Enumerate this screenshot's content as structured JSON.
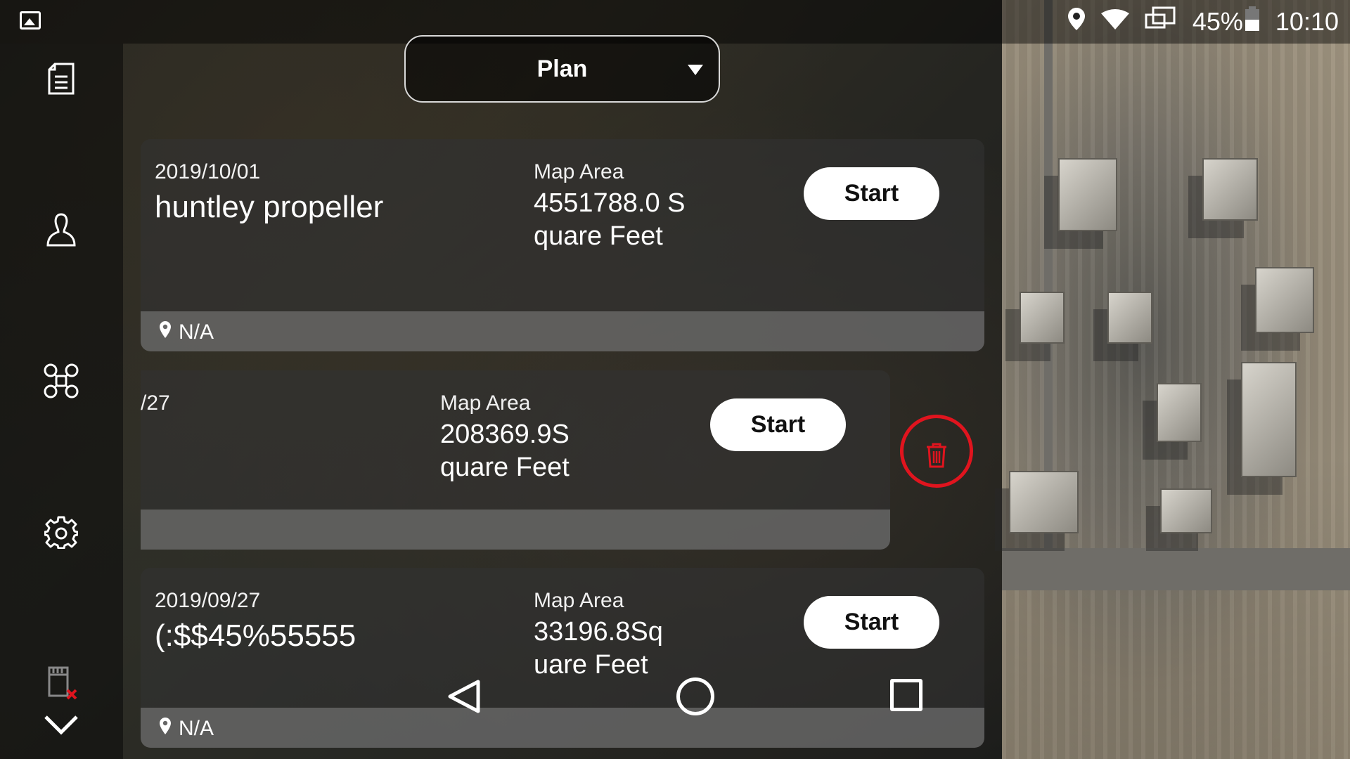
{
  "status": {
    "battery": "45%",
    "time": "10:10"
  },
  "header": {
    "dropdown_value": "Plan"
  },
  "plans": [
    {
      "date": "2019/10/01",
      "name": "huntley propeller",
      "area_label": "Map Area",
      "area_value": "4551788.0 Square Feet",
      "start_label": "Start",
      "location": "N/A"
    },
    {
      "date": "/27",
      "name": "",
      "area_label": "Map Area",
      "area_value": "208369.9Square Feet",
      "start_label": "Start",
      "location": ""
    },
    {
      "date": "2019/09/27",
      "name": "(:$$45%55555",
      "area_label": "Map Area",
      "area_value": "33196.8Square Feet",
      "start_label": "Start",
      "location": "N/A"
    }
  ],
  "icons": {
    "sidebar": [
      "document-icon",
      "user-icon",
      "drone-icon",
      "settings-gear-icon",
      "sd-card-error-icon",
      "chevron-down-icon"
    ],
    "status": [
      "gallery-icon",
      "location-icon",
      "wifi-icon",
      "screen-cast-icon",
      "battery-icon"
    ]
  },
  "colors": {
    "delete_highlight": "#e0141e",
    "start_button": "#ffffff"
  }
}
